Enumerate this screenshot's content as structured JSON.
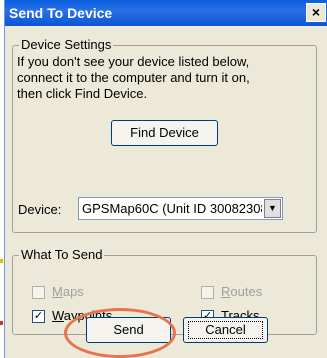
{
  "window": {
    "title": "Send To Device",
    "close_glyph": "×"
  },
  "device_settings": {
    "legend": "Device Settings",
    "help_lines": [
      "If you don't see your device listed below,",
      "connect it to the computer and turn it on,",
      "then click Find Device."
    ],
    "find_button": "Find Device",
    "device_label": "Device:",
    "device_value": "GPSMap60C (Unit ID 30082308"
  },
  "what_to_send": {
    "legend": "What To Send",
    "options": [
      {
        "label_first": "M",
        "label_rest": "aps",
        "checked": false,
        "enabled": false
      },
      {
        "label_first": "R",
        "label_rest": "outes",
        "checked": false,
        "enabled": false
      },
      {
        "label_first": "W",
        "label_rest": "aypoints",
        "checked": true,
        "enabled": true
      },
      {
        "label_first": "T",
        "label_rest": "racks",
        "checked": true,
        "enabled": true
      }
    ]
  },
  "buttons": {
    "send": "Send",
    "cancel": "Cancel"
  },
  "colors": {
    "titlebar": "#0a5fde",
    "dialog_bg": "#ece9d8",
    "highlight_ring": "#e9734f"
  },
  "icons": {
    "close": "close-icon",
    "dropdown": "chevron-down-icon",
    "check": "checkmark-icon"
  }
}
